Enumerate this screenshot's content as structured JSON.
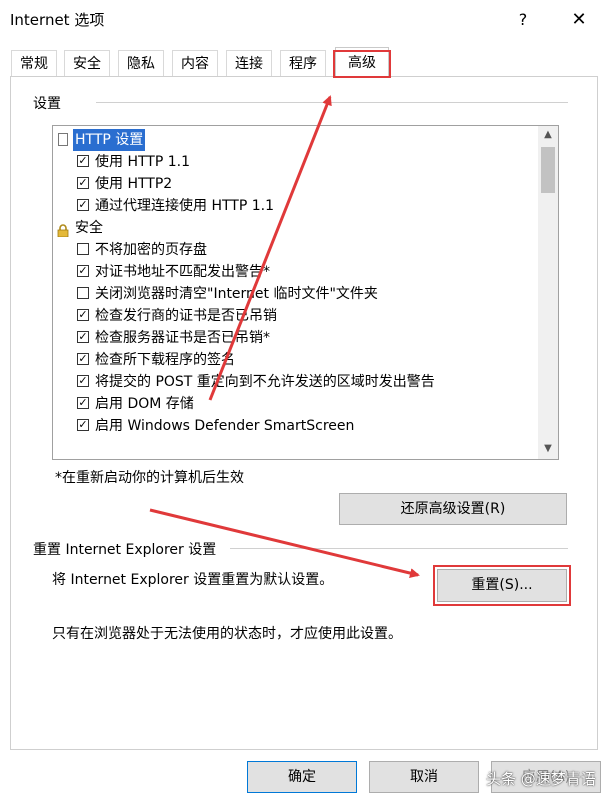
{
  "window": {
    "title": "Internet 选项",
    "help_label": "?",
    "close_label": "✕"
  },
  "tabs": [
    {
      "label": "常规"
    },
    {
      "label": "安全"
    },
    {
      "label": "隐私"
    },
    {
      "label": "内容"
    },
    {
      "label": "连接"
    },
    {
      "label": "程序"
    },
    {
      "label": "高级",
      "active": true
    }
  ],
  "settings": {
    "group_label": "设置",
    "rows": [
      {
        "type": "category",
        "label": "HTTP 设置",
        "icon": "page-icon",
        "selected": true
      },
      {
        "type": "checkbox",
        "label": "使用 HTTP 1.1",
        "checked": true
      },
      {
        "type": "checkbox",
        "label": "使用 HTTP2",
        "checked": true
      },
      {
        "type": "checkbox",
        "label": "通过代理连接使用 HTTP 1.1",
        "checked": true
      },
      {
        "type": "category",
        "label": "安全",
        "icon": "lock-icon"
      },
      {
        "type": "checkbox",
        "label": "不将加密的页存盘",
        "checked": false
      },
      {
        "type": "checkbox",
        "label": "对证书地址不匹配发出警告*",
        "checked": true
      },
      {
        "type": "checkbox",
        "label": "关闭浏览器时清空\"Internet 临时文件\"文件夹",
        "checked": false
      },
      {
        "type": "checkbox",
        "label": "检查发行商的证书是否已吊销",
        "checked": true
      },
      {
        "type": "checkbox",
        "label": "检查服务器证书是否已吊销*",
        "checked": true
      },
      {
        "type": "checkbox",
        "label": "检查所下载程序的签名",
        "checked": true
      },
      {
        "type": "checkbox",
        "label": "将提交的 POST 重定向到不允许发送的区域时发出警告",
        "checked": true
      },
      {
        "type": "checkbox",
        "label": "启用 DOM 存储",
        "checked": true
      },
      {
        "type": "checkbox",
        "label": "启用 Windows Defender SmartScreen",
        "checked": true
      }
    ],
    "note": "*在重新启动你的计算机后生效",
    "restore_button": "还原高级设置(R)"
  },
  "reset": {
    "group_label": "重置 Internet Explorer 设置",
    "description": "将 Internet Explorer 设置重置为默认设置。",
    "button": "重置(S)...",
    "note": "只有在浏览器处于无法使用的状态时，才应使用此设置。"
  },
  "footer": {
    "ok": "确定",
    "cancel": "取消",
    "apply": "应用(A)"
  },
  "watermark": "头条 @速梦青语",
  "colors": {
    "highlight_red": "#e0393a",
    "selection_blue": "#2a6ed0",
    "button_face": "#e1e1e1"
  }
}
